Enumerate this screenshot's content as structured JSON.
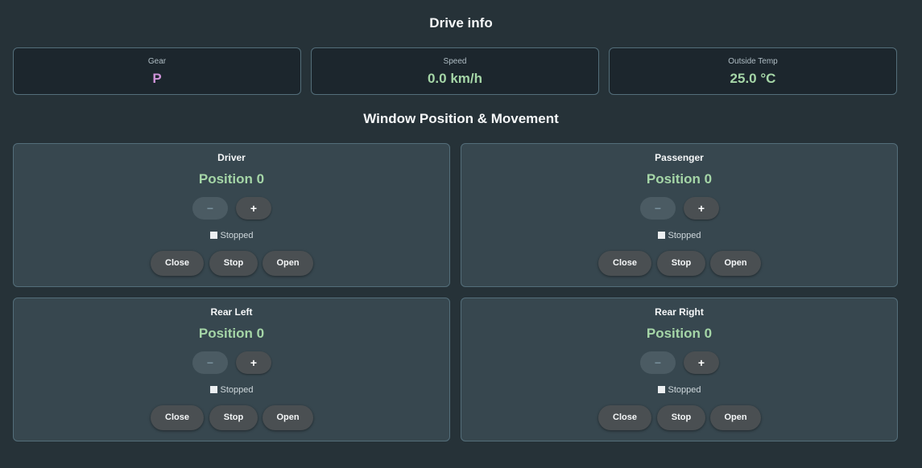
{
  "drive_info": {
    "title": "Drive info",
    "cards": [
      {
        "label": "Gear",
        "value": "P",
        "color": "#ce93d8"
      },
      {
        "label": "Speed",
        "value": "0.0 km/h",
        "color": "#a5d6a7"
      },
      {
        "label": "Outside Temp",
        "value": "25.0 °C",
        "color": "#a5d6a7"
      }
    ]
  },
  "windows": {
    "title": "Window Position & Movement",
    "minus_label": "−",
    "plus_label": "+",
    "close_label": "Close",
    "stop_label": "Stop",
    "open_label": "Open",
    "items": [
      {
        "name": "Driver",
        "position": "Position 0",
        "status": "Stopped"
      },
      {
        "name": "Passenger",
        "position": "Position 0",
        "status": "Stopped"
      },
      {
        "name": "Rear Left",
        "position": "Position 0",
        "status": "Stopped"
      },
      {
        "name": "Rear Right",
        "position": "Position 0",
        "status": "Stopped"
      }
    ]
  },
  "colors": {
    "background": "#263238",
    "card": "#37474f",
    "info_card": "#1c262d",
    "accent_green": "#a5d6a7",
    "accent_purple": "#ce93d8"
  }
}
